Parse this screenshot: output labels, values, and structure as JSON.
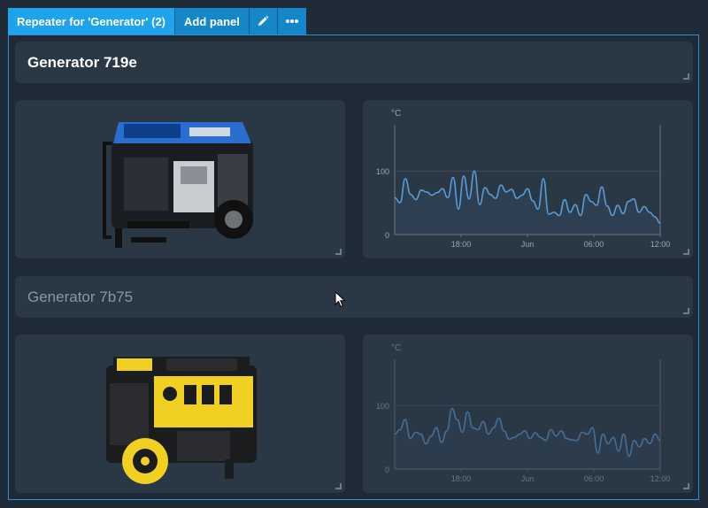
{
  "toolbar": {
    "title": "Repeater for 'Generator' (2)",
    "add_panel": "Add panel",
    "edit_icon": "pencil-icon",
    "more_icon": "ellipsis-icon"
  },
  "colors": {
    "accent": "#1fa3ea",
    "panel_bg": "#2a3846",
    "line": "#5b9bd5",
    "generator_1_body": "#2a6fd0",
    "generator_2_body": "#f0d020"
  },
  "rows": [
    {
      "title": "Generator 719e",
      "chart_unit": "°C",
      "chart_data": {
        "type": "line",
        "x_ticks": [
          "18:00",
          "Jun",
          "06:00",
          "12:00"
        ],
        "y_ticks": [
          "100",
          "0"
        ],
        "ylim": [
          0,
          170
        ],
        "series": [
          {
            "values": [
              58,
              50,
              88,
              63,
              55,
              70,
              67,
              62,
              66,
              72,
              58,
              90,
              40,
              92,
              56,
              100,
              47,
              74,
              63,
              57,
              78,
              67,
              71,
              57,
              62,
              72,
              53,
              40,
              88,
              32,
              35,
              30,
              55,
              35,
              47,
              30,
              63,
              52,
              46,
              75,
              45,
              30,
              46,
              33,
              52,
              56,
              35,
              44,
              35,
              28,
              18
            ]
          }
        ]
      }
    },
    {
      "title": "Generator 7b75",
      "chart_unit": "°C",
      "chart_data": {
        "type": "line",
        "x_ticks": [
          "18:00",
          "Jun",
          "06:00",
          "12:00"
        ],
        "y_ticks": [
          "100",
          "0"
        ],
        "ylim": [
          0,
          170
        ],
        "series": [
          {
            "values": [
              55,
              62,
              78,
              48,
              58,
              55,
              40,
              52,
              65,
              42,
              60,
              95,
              78,
              58,
              90,
              65,
              62,
              75,
              55,
              65,
              80,
              60,
              47,
              50,
              55,
              60,
              48,
              57,
              50,
              45,
              62,
              52,
              60,
              48,
              46,
              45,
              58,
              55,
              65,
              25,
              55,
              40,
              50,
              28,
              55,
              20,
              45,
              35,
              48,
              40,
              55,
              45
            ]
          }
        ]
      }
    }
  ]
}
